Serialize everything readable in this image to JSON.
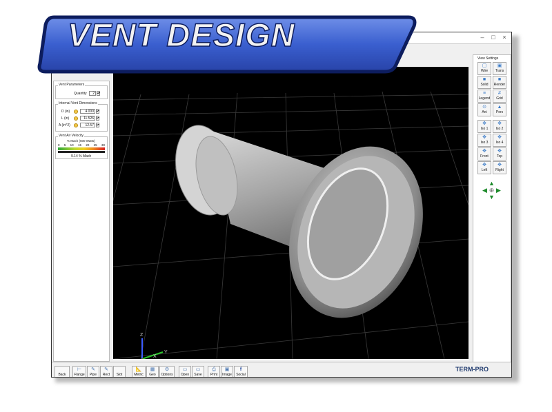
{
  "banner": {
    "title": "VENT DESIGN"
  },
  "left_panel": {
    "vent_params_title": "Vent Parameters",
    "quantity_label": "Quantity",
    "quantity_value": "2",
    "internal_dims_title": "Internal Vent Dimensions",
    "fields": [
      {
        "label": "D (in)",
        "value": "4.000"
      },
      {
        "label": "L (in)",
        "value": "11.526"
      },
      {
        "label": "A (in^2)",
        "value": "12.57"
      }
    ],
    "air_velocity_title": "Vent Air Velocity",
    "mach_label": "% Mach (600 Watts)",
    "scale_ticks": [
      "0",
      "5",
      "10",
      "15",
      "20",
      "25",
      "30"
    ],
    "velocity_readout": "9.14 % Mach"
  },
  "right_panel": {
    "title": "View Settings",
    "buttons": [
      [
        "Wire",
        "Trans"
      ],
      [
        "Solid",
        "Render"
      ],
      [
        "Legend",
        "Grid"
      ],
      [
        "Ani",
        "Pers"
      ],
      [
        "Iso 1",
        "Iso 2"
      ],
      [
        "Iso 3",
        "Iso 4"
      ],
      [
        "Front",
        "Top"
      ],
      [
        "Left",
        "Right"
      ]
    ]
  },
  "axes": {
    "z": "Z",
    "y": "Y",
    "x": "X"
  },
  "bottom_bar": {
    "back": "Back",
    "buttons": [
      "Flange",
      "Pipe",
      "Rect",
      "Slot",
      "Metric",
      "Geo",
      "Options",
      "Open",
      "Save",
      "Print",
      "Image",
      "Social"
    ],
    "brand": "TERM-PRO"
  },
  "colors": {
    "banner_fill": "#3a5fcf",
    "banner_border": "#0d1d5e",
    "viewport_bg": "#000000",
    "nav_arrow": "#1c8a2a"
  }
}
